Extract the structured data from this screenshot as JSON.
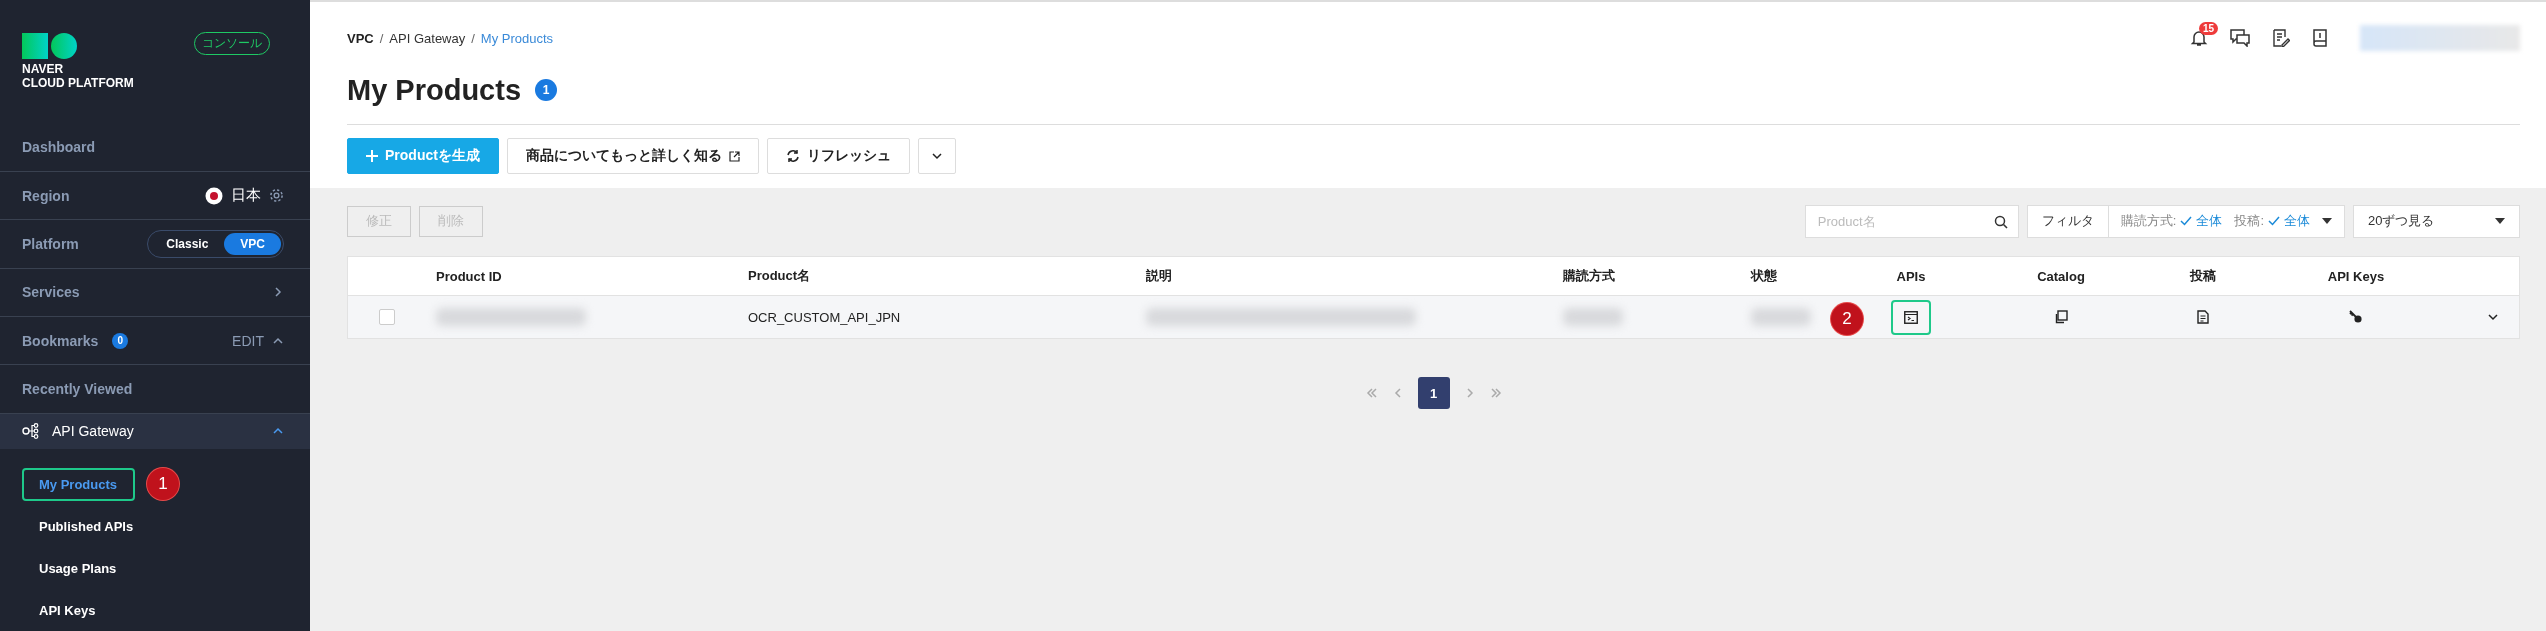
{
  "sidebar": {
    "logo": {
      "line_1": "NAVER",
      "line_2": "CLOUD PLATFORM"
    },
    "console_badge": "コンソール",
    "items": [
      {
        "kind": "link",
        "label": "Dashboard"
      },
      {
        "kind": "region",
        "label": "Region",
        "value": "日本"
      },
      {
        "kind": "platform",
        "label": "Platform",
        "options": [
          {
            "label": "Classic",
            "selected": false
          },
          {
            "label": "VPC",
            "selected": true
          }
        ]
      },
      {
        "kind": "nav",
        "label": "Services"
      },
      {
        "kind": "bookmarks",
        "label": "Bookmarks",
        "count": "0",
        "action": "EDIT",
        "expanded": true
      },
      {
        "kind": "link",
        "label": "Recently Viewed"
      }
    ],
    "service": {
      "label": "API Gateway",
      "expanded": true,
      "children": [
        {
          "label": "My Products",
          "selected": true,
          "highlighted": true,
          "callout": "1"
        },
        {
          "label": "Published APIs",
          "selected": false,
          "highlighted": false
        },
        {
          "label": "Usage Plans",
          "selected": false,
          "highlighted": false
        },
        {
          "label": "API Keys",
          "selected": false,
          "highlighted": false
        }
      ]
    }
  },
  "header": {
    "notification_count": "15"
  },
  "breadcrumb": [
    {
      "kind": "root",
      "label": "VPC",
      "separator": "/"
    },
    {
      "kind": "link",
      "label": "API Gateway",
      "separator": "/"
    },
    {
      "kind": "current",
      "label": "My Products"
    }
  ],
  "title": "My Products",
  "title_count": "1",
  "toolbar": [
    {
      "kind": "create",
      "label": "Productを生成"
    },
    {
      "kind": "external",
      "label": "商品についてもっと詳しく知る"
    },
    {
      "kind": "refresh",
      "label": "リフレッシュ"
    },
    {
      "kind": "more"
    }
  ],
  "actions": [
    {
      "label": "修正",
      "disabled": true
    },
    {
      "label": "削除",
      "disabled": true
    }
  ],
  "search": {
    "placeholder": "Product名"
  },
  "filter": {
    "label": "フィルタ",
    "conditions": [
      {
        "label": "購読方式:",
        "value": "全体"
      },
      {
        "label": "投稿:",
        "value": "全体"
      }
    ]
  },
  "page_size": "20ずつ見る",
  "table": {
    "columns": [
      {
        "kind": "text",
        "label": "Product ID"
      },
      {
        "kind": "text",
        "label": "Product名"
      },
      {
        "kind": "text",
        "label": "説明"
      },
      {
        "kind": "text",
        "label": "購読方式"
      },
      {
        "kind": "text",
        "label": "状態"
      },
      {
        "kind": "icon",
        "label": "APIs"
      },
      {
        "kind": "icon",
        "label": "Catalog"
      },
      {
        "kind": "icon",
        "label": "投稿"
      },
      {
        "kind": "icon",
        "label": "API Keys"
      }
    ],
    "rows": [
      {
        "checked": false,
        "expanded": false,
        "cells": [
          {
            "kind": "blurred"
          },
          {
            "kind": "text",
            "text": "OCR_CUSTOM_API_JPN"
          },
          {
            "kind": "blurred"
          },
          {
            "kind": "blurred"
          },
          {
            "kind": "blurred"
          },
          {
            "kind": "apis",
            "highlighted": true,
            "callout": "2"
          },
          {
            "kind": "catalog",
            "highlighted": false
          },
          {
            "kind": "post",
            "highlighted": false
          },
          {
            "kind": "keys",
            "highlighted": false
          }
        ]
      }
    ]
  },
  "pagination": {
    "pages": [
      {
        "label": "1",
        "selected": true
      }
    ]
  }
}
